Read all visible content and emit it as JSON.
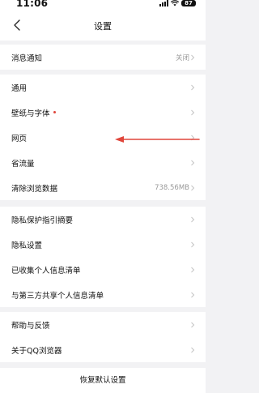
{
  "status_bar": {
    "time": "11:06",
    "battery": "87"
  },
  "header": {
    "title": "设置"
  },
  "groups": [
    {
      "items": [
        {
          "label": "消息通知",
          "value": "关闭"
        }
      ]
    },
    {
      "items": [
        {
          "label": "通用"
        },
        {
          "label": "壁纸与字体",
          "dot": true
        },
        {
          "label": "网页"
        },
        {
          "label": "省流量"
        },
        {
          "label": "清除浏览数据",
          "value": "738.56MB"
        }
      ]
    },
    {
      "items": [
        {
          "label": "隐私保护指引摘要"
        },
        {
          "label": "隐私设置"
        },
        {
          "label": "已收集个人信息清单"
        },
        {
          "label": "与第三方共享个人信息清单"
        }
      ]
    },
    {
      "items": [
        {
          "label": "帮助与反馈"
        },
        {
          "label": "关于QQ浏览器"
        }
      ]
    }
  ],
  "footer": {
    "reset_label": "恢复默认设置"
  },
  "colors": {
    "annotation_arrow": "#e0463b",
    "badge_dot": "#e0463b"
  }
}
